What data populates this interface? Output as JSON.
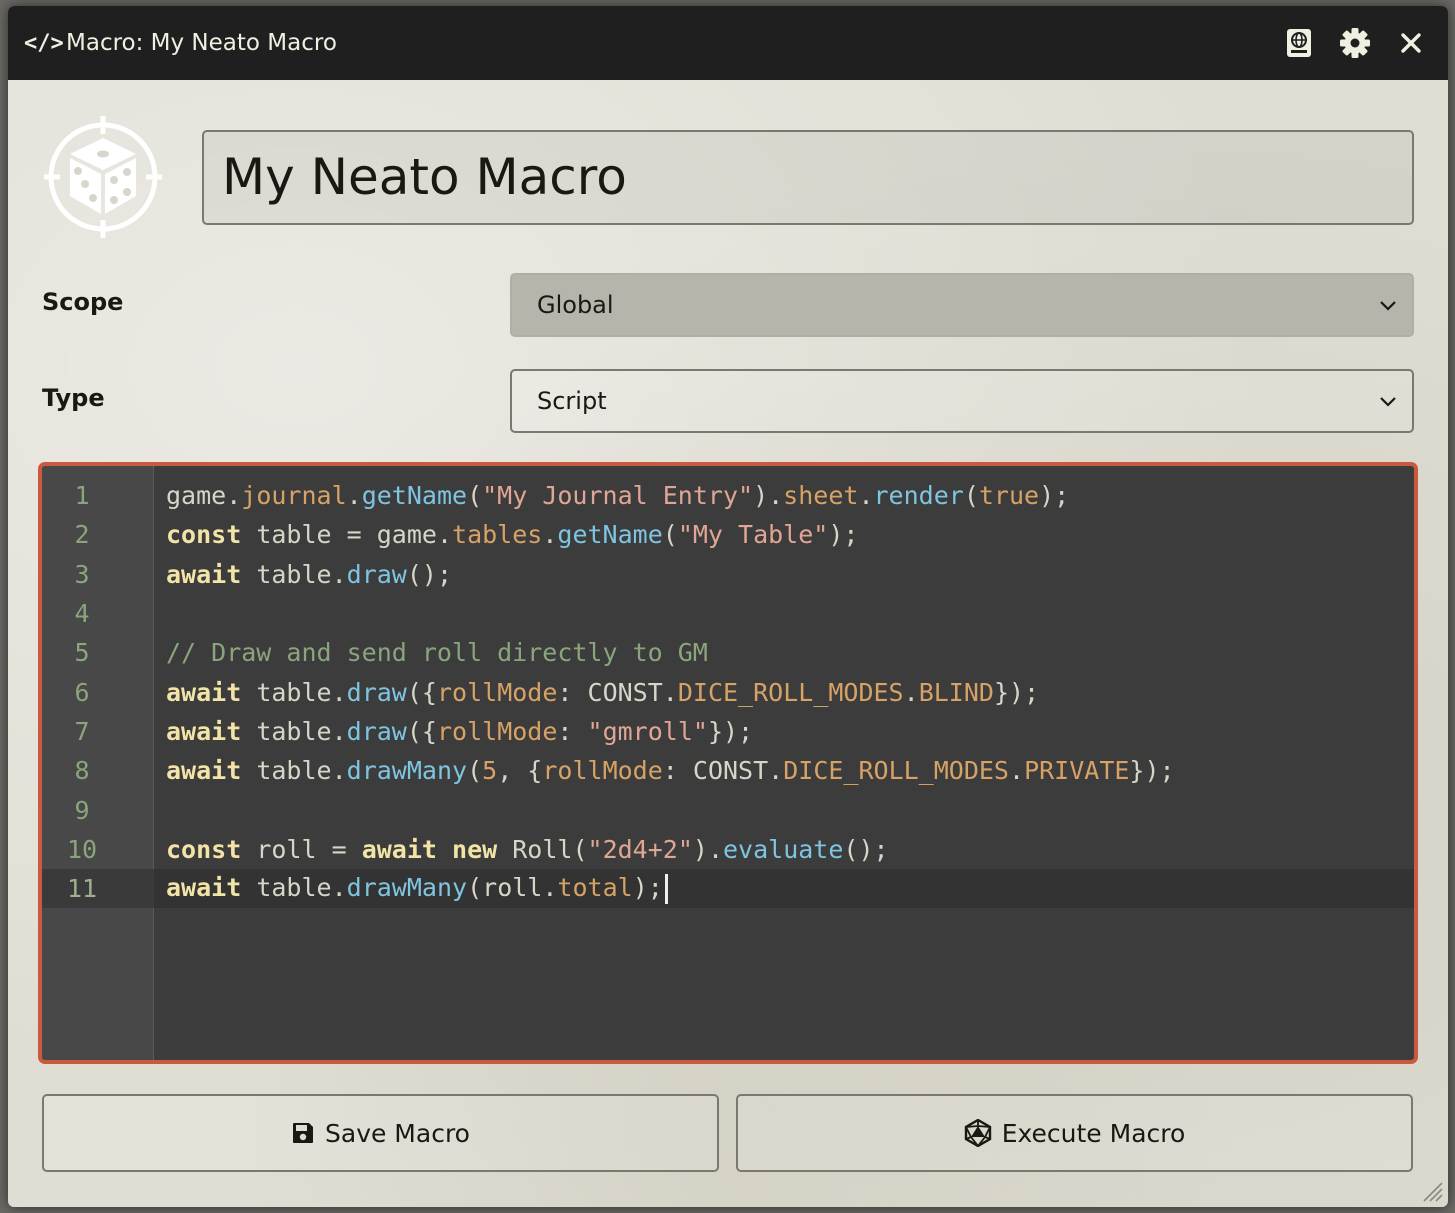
{
  "window": {
    "title": "Macro: My Neato Macro",
    "title_icon": "</>"
  },
  "header_controls": [
    "journal-icon",
    "gear-icon",
    "close-icon"
  ],
  "macro": {
    "image_icon": "dice-target-icon",
    "name": "My Neato Macro"
  },
  "form": {
    "scope_label": "Scope",
    "scope_value": "Global",
    "type_label": "Type",
    "type_value": "Script"
  },
  "editor": {
    "line_numbers": [
      "1",
      "2",
      "3",
      "4",
      "5",
      "6",
      "7",
      "8",
      "9",
      "10",
      "11"
    ],
    "active_line": 11,
    "lines": [
      "game.journal.getName(\"My Journal Entry\").sheet.render(true);",
      "const table = game.tables.getName(\"My Table\");",
      "await table.draw();",
      "",
      "// Draw and send roll directly to GM",
      "await table.draw({rollMode: CONST.DICE_ROLL_MODES.BLIND});",
      "await table.draw({rollMode: \"gmroll\"});",
      "await table.drawMany(5, {rollMode: CONST.DICE_ROLL_MODES.PRIVATE});",
      "",
      "const roll = await new Roll(\"2d4+2\").evaluate();",
      "await table.drawMany(roll.total);"
    ]
  },
  "buttons": {
    "save_label": "Save Macro",
    "execute_label": "Execute Macro"
  },
  "colors": {
    "accent_border": "#c9593f",
    "titlebar": "#1f1f20",
    "editor_bg": "#3c3c3c"
  }
}
